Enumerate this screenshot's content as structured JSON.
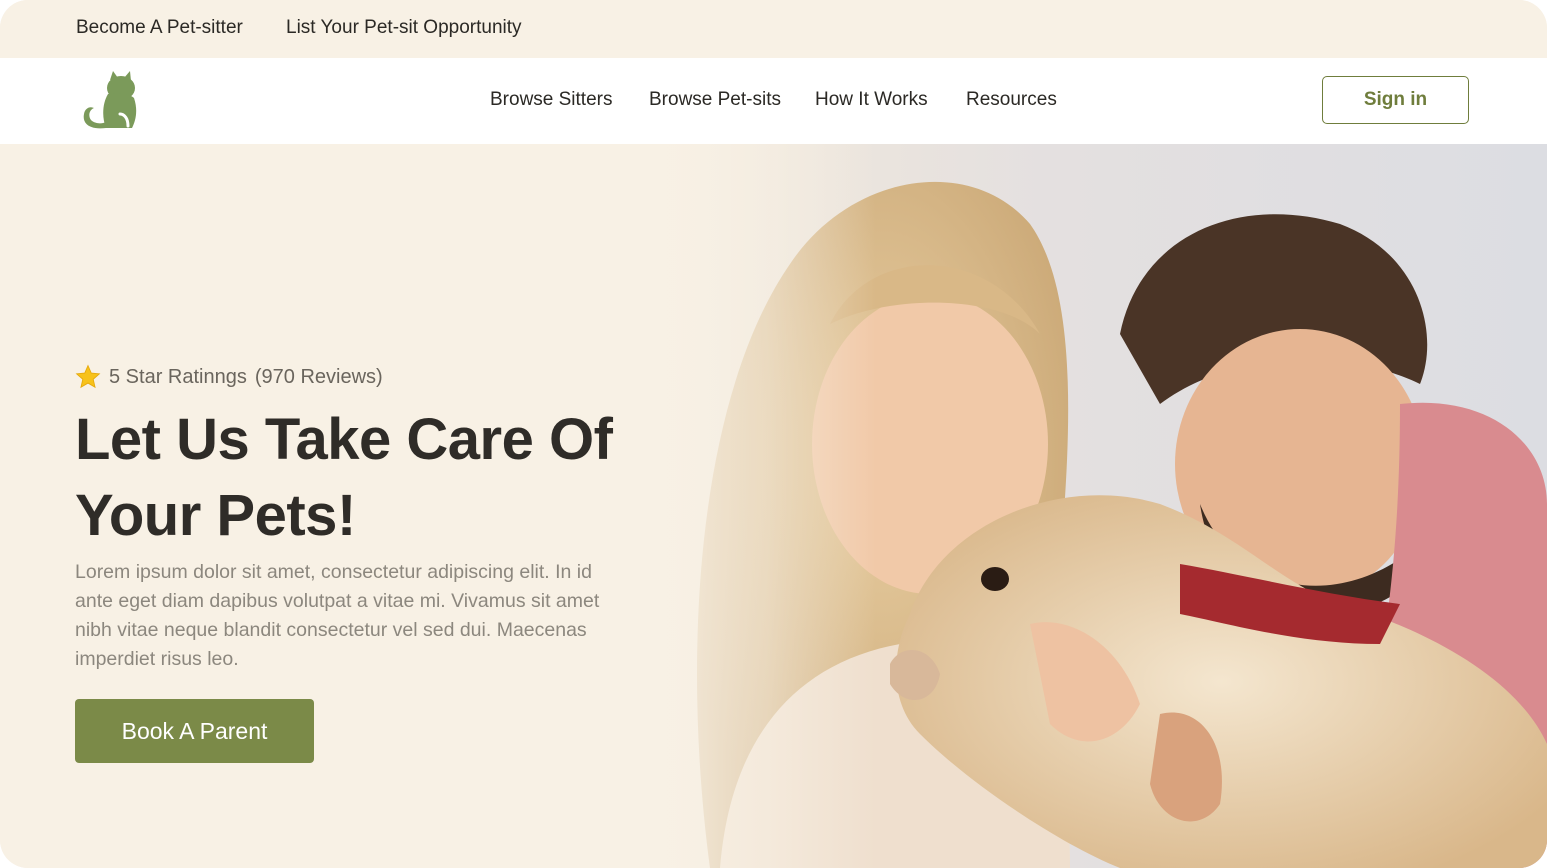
{
  "topbar": {
    "links": [
      "Become A Pet-sitter",
      "List Your Pet-sit Opportunity"
    ]
  },
  "nav": {
    "logo_icon": "cat-logo-icon",
    "links": [
      "Browse Sitters",
      "Browse Pet-sits",
      "How It Works",
      "Resources"
    ],
    "sign_in_label": "Sign in"
  },
  "hero": {
    "rating_icon": "star-icon",
    "rating_text": "5 Star Ratinngs",
    "reviews_text": "(970 Reviews)",
    "headline_line1": "Let Us Take Care Of",
    "headline_line2": "Your Pets!",
    "description": "Lorem ipsum dolor sit amet, consectetur adipiscing elit. In id ante eget diam dapibus volutpat a vitae mi. Vivamus sit amet nibh vitae neque blandit consectetur vel sed dui. Maecenas imperdiet risus leo.",
    "cta_label": "Book A Parent",
    "photo": "couple-hugging-dog-photo"
  },
  "colors": {
    "accent": "#7b8a48",
    "background": "#f8f1e5",
    "text": "#2b2925"
  }
}
